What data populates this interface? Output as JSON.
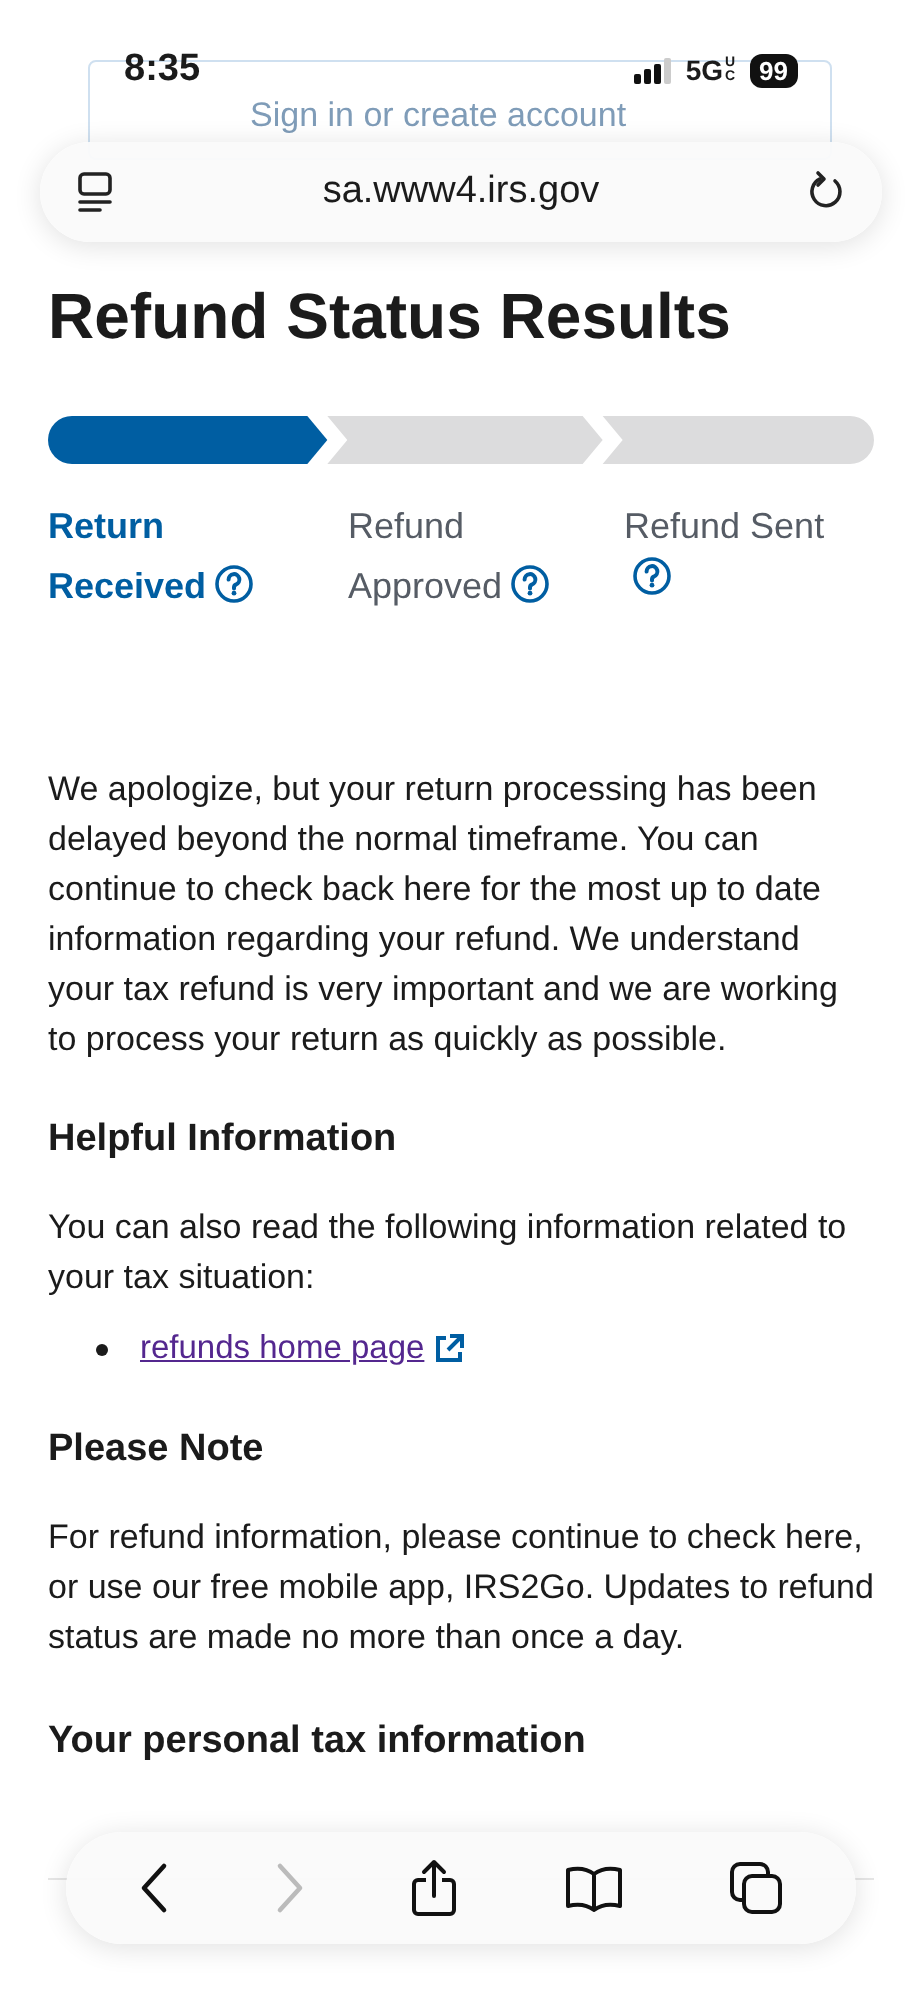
{
  "status_bar": {
    "time": "8:35",
    "network": "5G",
    "network_suffix": "UC",
    "battery": "99"
  },
  "header": {
    "sign_in_button": "Sign in or create account"
  },
  "address_bar": {
    "url": "sa.www4.irs.gov"
  },
  "title": "Refund Status Results",
  "steps": [
    {
      "label": "Return Received",
      "active": true
    },
    {
      "label": "Refund Approved",
      "active": false
    },
    {
      "label": "Refund Sent",
      "active": false
    }
  ],
  "message": "We apologize, but your return processing has been delayed beyond the normal timeframe. You can continue to check back here for the most up to date information regarding your refund. We understand your tax refund is very important and we are working to process your return as quickly as possible.",
  "sections": [
    {
      "kind": "links",
      "heading": "Helpful Information",
      "text": "You can also read the following information related to your tax situation:",
      "links": [
        "refunds home page"
      ]
    },
    {
      "kind": "text",
      "heading": "Please Note",
      "text": "For refund information, please continue to check here, or use our free mobile app, IRS2Go. Updates to refund status are made no more than once a day."
    },
    {
      "kind": "heading",
      "heading": "Your personal tax information"
    }
  ],
  "toolbar": {
    "back_enabled": true,
    "forward_enabled": false
  }
}
